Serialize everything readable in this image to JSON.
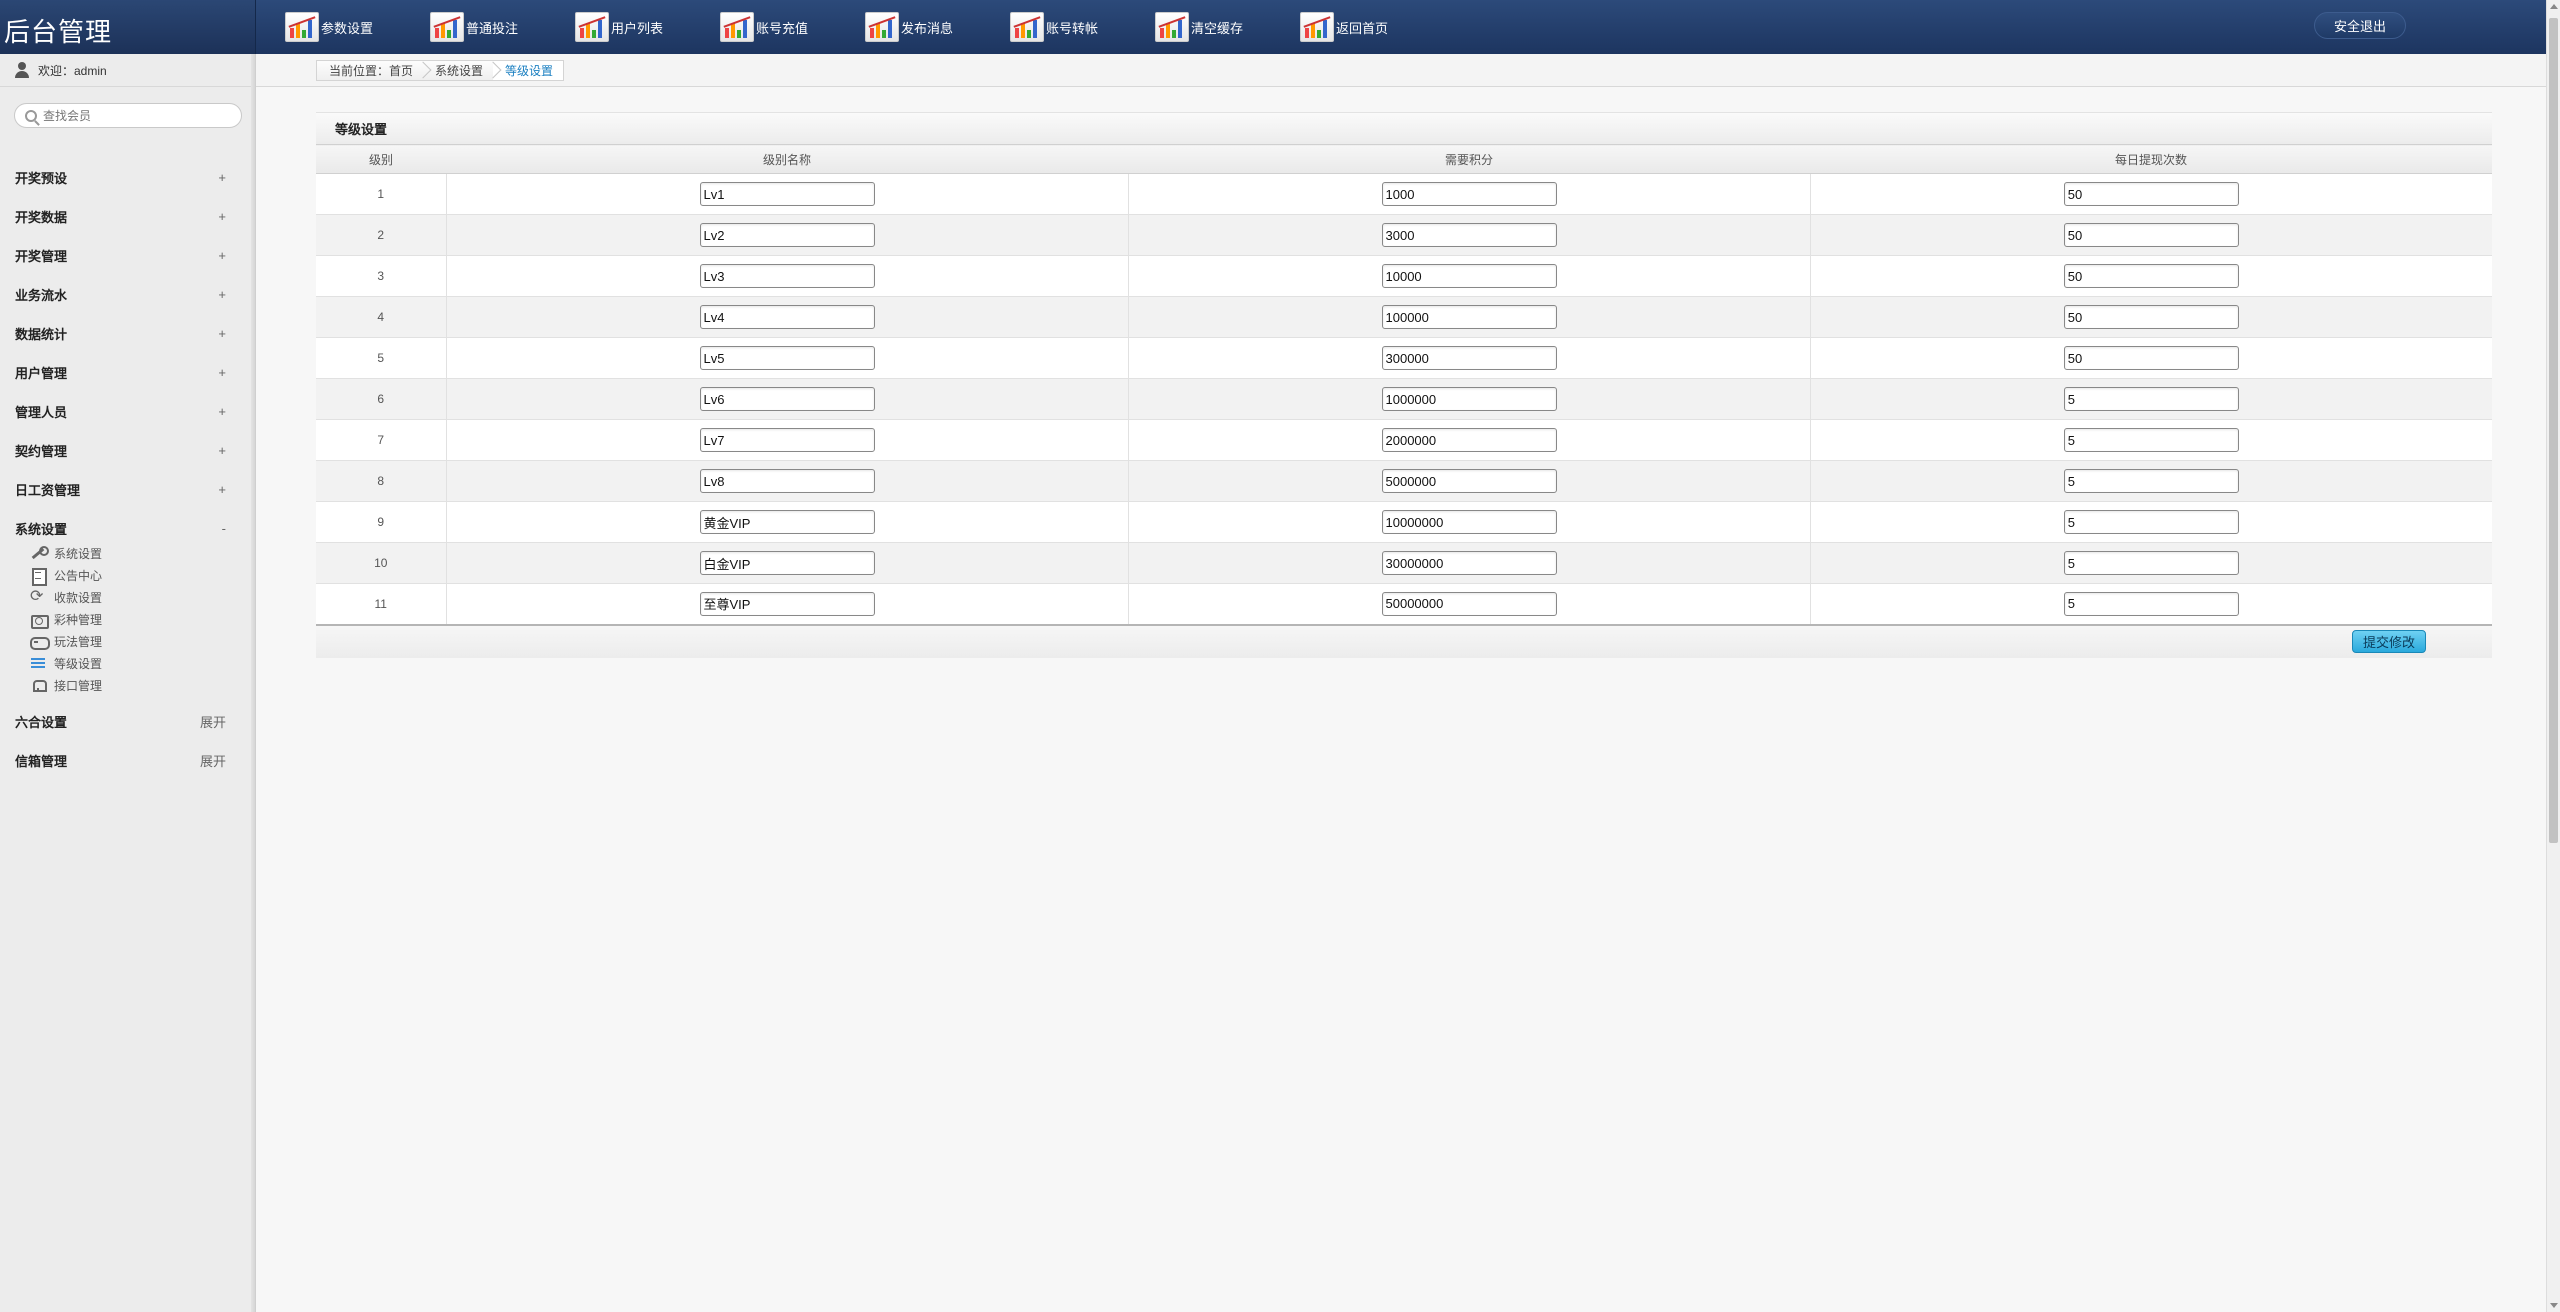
{
  "app": {
    "title": "后台管理"
  },
  "topnav": [
    {
      "label": "参数设置",
      "icon": "chart-icon"
    },
    {
      "label": "普通投注",
      "icon": "chart-icon"
    },
    {
      "label": "用户列表",
      "icon": "chart-icon"
    },
    {
      "label": "账号充值",
      "icon": "chart-icon"
    },
    {
      "label": "发布消息",
      "icon": "chart-icon"
    },
    {
      "label": "账号转帐",
      "icon": "chart-icon"
    },
    {
      "label": "清空缓存",
      "icon": "chart-icon"
    },
    {
      "label": "返回首页",
      "icon": "chart-icon"
    }
  ],
  "logout_label": "安全退出",
  "sidebar": {
    "welcome": "欢迎：admin",
    "search_placeholder": "查找会员",
    "menu": [
      {
        "label": "开奖预设",
        "toggle": "+"
      },
      {
        "label": "开奖数据",
        "toggle": "+"
      },
      {
        "label": "开奖管理",
        "toggle": "+"
      },
      {
        "label": "业务流水",
        "toggle": "+"
      },
      {
        "label": "数据统计",
        "toggle": "+"
      },
      {
        "label": "用户管理",
        "toggle": "+"
      },
      {
        "label": "管理人员",
        "toggle": "+"
      },
      {
        "label": "契约管理",
        "toggle": "+"
      },
      {
        "label": "日工资管理",
        "toggle": "+"
      },
      {
        "label": "系统设置",
        "toggle": "-"
      }
    ],
    "submenu": [
      {
        "label": "系统设置",
        "icon": "wrench-icon"
      },
      {
        "label": "公告中心",
        "icon": "clipboard-icon"
      },
      {
        "label": "收款设置",
        "icon": "sync-icon"
      },
      {
        "label": "彩种管理",
        "icon": "camera-icon"
      },
      {
        "label": "玩法管理",
        "icon": "gamepad-icon"
      },
      {
        "label": "等级设置",
        "icon": "level-icon"
      },
      {
        "label": "接口管理",
        "icon": "plug-icon"
      }
    ],
    "menu_after": [
      {
        "label": "六合设置",
        "toggle": "展开"
      },
      {
        "label": "信箱管理",
        "toggle": "展开"
      }
    ]
  },
  "breadcrumb": [
    "当前位置：首页",
    "系统设置",
    "等级设置"
  ],
  "panel": {
    "title": "等级设置",
    "columns": [
      "级别",
      "级别名称",
      "需要积分",
      "每日提现次数"
    ],
    "rows": [
      {
        "level": "1",
        "name": "Lv1",
        "points": "1000",
        "withdraw": "50"
      },
      {
        "level": "2",
        "name": "Lv2",
        "points": "3000",
        "withdraw": "50"
      },
      {
        "level": "3",
        "name": "Lv3",
        "points": "10000",
        "withdraw": "50"
      },
      {
        "level": "4",
        "name": "Lv4",
        "points": "100000",
        "withdraw": "50"
      },
      {
        "level": "5",
        "name": "Lv5",
        "points": "300000",
        "withdraw": "50"
      },
      {
        "level": "6",
        "name": "Lv6",
        "points": "1000000",
        "withdraw": "5"
      },
      {
        "level": "7",
        "name": "Lv7",
        "points": "2000000",
        "withdraw": "5"
      },
      {
        "level": "8",
        "name": "Lv8",
        "points": "5000000",
        "withdraw": "5"
      },
      {
        "level": "9",
        "name": "黄金VIP",
        "points": "10000000",
        "withdraw": "5"
      },
      {
        "level": "10",
        "name": "白金VIP",
        "points": "30000000",
        "withdraw": "5"
      },
      {
        "level": "11",
        "name": "至尊VIP",
        "points": "50000000",
        "withdraw": "5"
      }
    ],
    "submit_label": "提交修改"
  },
  "colors": {
    "header": "#1d3560",
    "accent": "#2aa9dc",
    "breadcrumb_active": "#1a7fc1"
  }
}
